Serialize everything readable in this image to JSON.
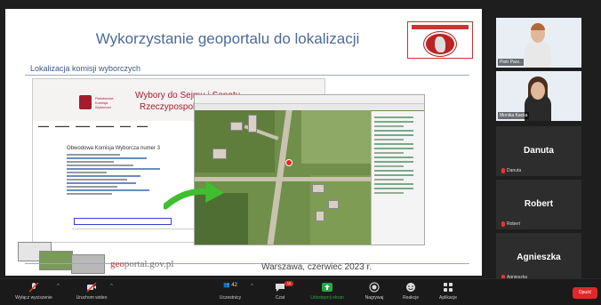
{
  "slide": {
    "title": "Wykorzystanie geoportalu do lokalizacji",
    "subtitle": "Lokalizacja komisji wyborczych",
    "footer_logo_a": "geo",
    "footer_logo_b": "portal.gov.pl",
    "footer_city": "Warszawa, czerwiec 2023 r.",
    "pkw_title_1": "Wybory do Sejmu i Senatu",
    "pkw_title_2": "Rzeczypospolitej Polskiej",
    "pkw_heading": "Obwodowa Komisja Wyborcza numer 3"
  },
  "participants": [
    {
      "name": "Piotr Parz..",
      "type": "video"
    },
    {
      "name": "Monika Kacka",
      "type": "video"
    },
    {
      "name": "Danuta",
      "small": "Danuta",
      "type": "name"
    },
    {
      "name": "Robert",
      "small": "Robert",
      "type": "name"
    },
    {
      "name": "Agnieszka",
      "small": "Agnieszka",
      "type": "name"
    }
  ],
  "toolbar": {
    "mute": "Wyłącz wyciszenie",
    "video": "Uruchom wideo",
    "participants": "Uczestnicy",
    "participants_count": "42",
    "chat": "Czat",
    "chat_badge": "16",
    "share": "Udostępnij ekran",
    "record": "Nagrywaj",
    "reactions": "Reakcje",
    "apps": "Aplikacje",
    "leave": "Opuść"
  },
  "colors": {
    "accent_red": "#e02828",
    "slide_title": "#4a6b9a",
    "pkw_red": "#a51d2d",
    "share_green": "#27a844"
  }
}
